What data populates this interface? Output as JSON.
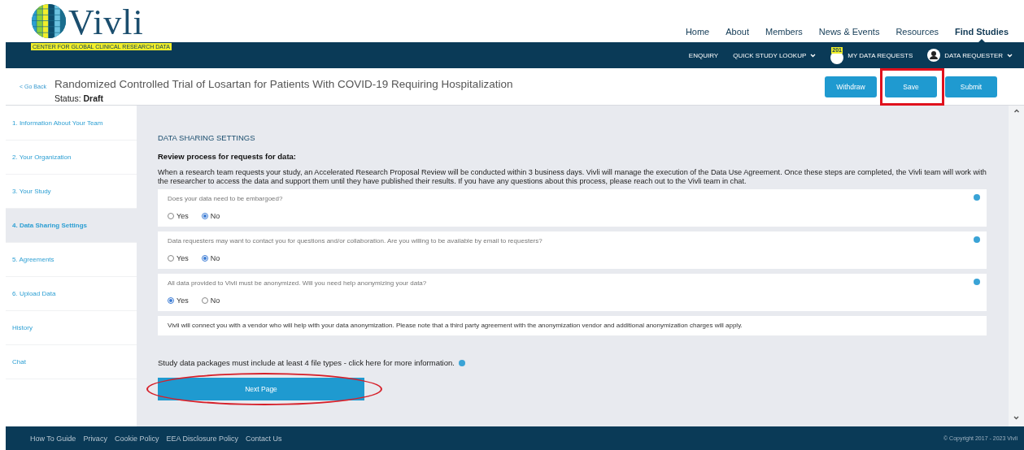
{
  "brand": {
    "name": "Vivli",
    "tagline": "CENTER FOR GLOBAL CLINICAL RESEARCH DATA"
  },
  "top_nav": [
    {
      "label": "Home",
      "selected": false
    },
    {
      "label": "About",
      "selected": false
    },
    {
      "label": "Members",
      "selected": false
    },
    {
      "label": "News & Events",
      "selected": false
    },
    {
      "label": "Resources",
      "selected": false
    },
    {
      "label": "Find Studies",
      "selected": true
    }
  ],
  "sub_nav": [
    {
      "label": "ENQUIRY",
      "kind": "plain"
    },
    {
      "label": "QUICK STUDY LOOKUP",
      "kind": "dropdown"
    },
    {
      "label": "MY DATA REQUESTS",
      "kind": "badge",
      "badge": "201"
    },
    {
      "label": "DATA REQUESTER",
      "kind": "user"
    }
  ],
  "request": {
    "back": "< Go Back",
    "title": "Randomized Controlled Trial of Losartan for Patients With COVID-19 Requiring Hospitalization",
    "status_label": "Status:",
    "status": "Draft"
  },
  "actions": [
    {
      "label": "Withdraw",
      "highlighted": false
    },
    {
      "label": "Save",
      "highlighted": true
    },
    {
      "label": "Submit",
      "highlighted": false
    }
  ],
  "steps": [
    {
      "label": "1. Information About Your Team",
      "selected": false
    },
    {
      "label": "2. Your Organization",
      "selected": false
    },
    {
      "label": "3. Your Study",
      "selected": false
    },
    {
      "label": "4. Data Sharing Settings",
      "selected": true
    },
    {
      "label": "5. Agreements",
      "selected": false
    },
    {
      "label": "6. Upload Data",
      "selected": false
    },
    {
      "label": "History",
      "selected": false
    },
    {
      "label": "Chat",
      "selected": false
    }
  ],
  "section": {
    "title": "DATA SHARING SETTINGS",
    "heading": "Review process for requests for data:",
    "intro": "When a research team requests your study, an Accelerated Research Proposal Review will be conducted within 3 business days. Vivli will manage the execution of the Data Use Agreement. Once these steps are completed, the Vivli team will work with the researcher to access the data and support them until they have published their results. If you have any questions about this process, please reach out to the Vivli team in chat."
  },
  "questions": [
    {
      "text": "Does your data need to be embargoed?",
      "options": [
        {
          "label": "Yes",
          "selected": false
        },
        {
          "label": "No",
          "selected": true
        }
      ]
    },
    {
      "text": "Data requesters may want to contact you for questions and/or collaboration. Are you willing to be available by email to requesters?",
      "options": [
        {
          "label": "Yes",
          "selected": false
        },
        {
          "label": "No",
          "selected": true
        }
      ]
    },
    {
      "text": "All data provided to Vivli must be anonymized. Will you need help anonymizing your data?",
      "options": [
        {
          "label": "Yes",
          "selected": true
        },
        {
          "label": "No",
          "selected": false
        }
      ]
    }
  ],
  "notice": "Vivli will connect you with a vendor who will help with your data anonymization. Please note that a third party agreement with the anonymization vendor and additional anonymization charges will apply.",
  "file_types_note": "Study data packages must include at least 4 file types - click here for more information.",
  "next_button": {
    "label": "Next Page",
    "highlighted": true
  },
  "footer": {
    "links": [
      "How To Guide",
      "Privacy",
      "Cookie Policy",
      "EEA Disclosure Policy",
      "Contact Us"
    ],
    "copyright": "© Copyright 2017 - 2023 Vivli"
  }
}
